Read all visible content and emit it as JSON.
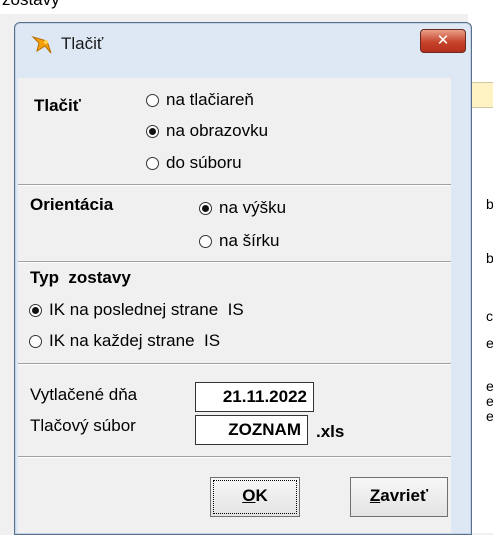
{
  "background": {
    "top_clip_text": "zostavy",
    "side_glyphs": [
      "b",
      "b",
      "c",
      "e",
      "e",
      "e",
      "e"
    ]
  },
  "window": {
    "title": "Tlačiť",
    "close_glyph": "✕",
    "app_icon": "fox-icon"
  },
  "print_group": {
    "title": "Tlačiť",
    "options": [
      {
        "label": "na tlačiareň",
        "selected": false
      },
      {
        "label": "na obrazovku",
        "selected": true
      },
      {
        "label": "do súboru",
        "selected": false
      }
    ]
  },
  "orientation_group": {
    "title": "Orientácia",
    "options": [
      {
        "label": "na výšku",
        "selected": true
      },
      {
        "label": "na šírku",
        "selected": false
      }
    ]
  },
  "type_group": {
    "title": "Typ  zostavy",
    "options": [
      {
        "label": "IK na poslednej strane  IS",
        "selected": true
      },
      {
        "label": "IK na každej strane  IS",
        "selected": false
      }
    ]
  },
  "fields": {
    "printed_date_label": "Vytlačené dňa",
    "printed_date_value": "21.11.2022",
    "print_file_label": "Tlačový súbor",
    "print_file_value": "ZOZNAM",
    "print_file_ext": ".xls"
  },
  "buttons": {
    "ok": {
      "underline": "O",
      "rest": "K"
    },
    "close": {
      "underline": "Z",
      "rest": "avrieť"
    }
  }
}
